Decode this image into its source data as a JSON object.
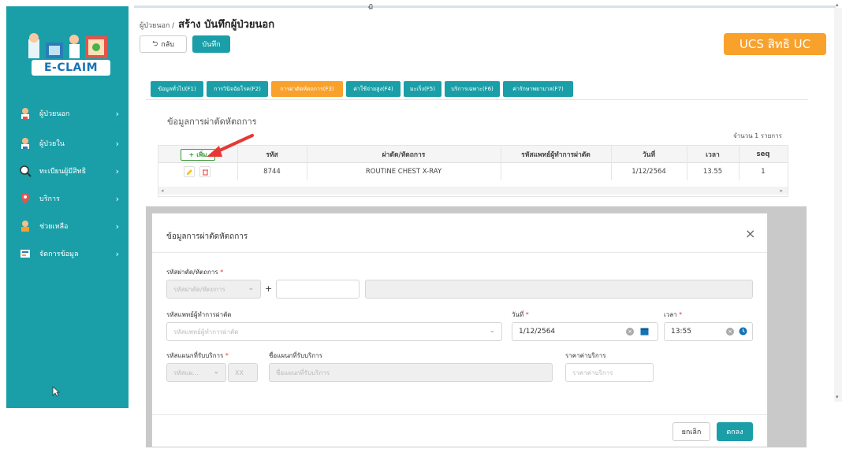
{
  "colors": {
    "primary": "#1a9fa8",
    "accent": "#f8a12b",
    "required": "#e53935",
    "add": "#3a9a3a"
  },
  "top_mark": "ฏ",
  "sidebar": {
    "logo": "E-CLAIM",
    "items": [
      {
        "label": "ผู้ป่วยนอก",
        "icon": "doctor-opd-icon"
      },
      {
        "label": "ผู้ป่วยใน",
        "icon": "doctor-ipd-icon"
      },
      {
        "label": "ทะเบียนผู้มีสิทธิ",
        "icon": "search-doc-icon"
      },
      {
        "label": "บริการ",
        "icon": "location-pin-icon"
      },
      {
        "label": "ช่วยเหลือ",
        "icon": "helper-person-icon"
      },
      {
        "label": "จัดการข้อมูล",
        "icon": "data-manage-icon"
      }
    ],
    "chevron": "›"
  },
  "header": {
    "breadcrumb_parent": "ผู้ป่วยนอก /",
    "title": "สร้าง บันทึกผู้ป่วยนอก",
    "back_label": "กลับ",
    "save_label": "บันทึก",
    "badge": "UCS สิทธิ UC"
  },
  "tabs": [
    {
      "label": "ข้อมูลทั่วไป(F1)",
      "active": false
    },
    {
      "label": "การวินิจฉัยโรค(F2)",
      "active": false
    },
    {
      "label": "การผ่าตัดหัตถการ(F3)",
      "active": true
    },
    {
      "label": "ค่าใช้จ่ายสูง(F4)",
      "active": false
    },
    {
      "label": "มะเร็ง(F5)",
      "active": false
    },
    {
      "label": "บริการเฉพาะ(F6)",
      "active": false
    },
    {
      "label": "ค่ารักษาพยาบาล(F7)",
      "active": false
    }
  ],
  "section": {
    "title": "ข้อมูลการผ่าตัดหัตถการ",
    "count": "จำนวน 1 รายการ"
  },
  "table": {
    "add_label": "เพิ่ม",
    "headers": [
      "รหัส",
      "ผ่าตัด/หัตถการ",
      "รหัสแพทย์ผู้ทำการผ่าตัด",
      "วันที่",
      "เวลา",
      "seq"
    ],
    "rows": [
      {
        "code": "8744",
        "procedure": "ROUTINE CHEST X-RAY",
        "doctor": "",
        "date": "1/12/2564",
        "time": "13.55",
        "seq": "1"
      }
    ]
  },
  "modal": {
    "title": "ข้อมูลการผ่าตัดหัตถการ",
    "procedure_code_label": "รหัสผ่าตัด/หัตถการ",
    "procedure_code_placeholder": "รหัสผ่าตัด/หัตถการ",
    "procedure_code_value": "",
    "procedure_name_value": "",
    "doctor_label": "รหัสแพทย์ผู้ทำการผ่าตัด",
    "doctor_placeholder": "รหัสแพทย์ผู้ทำการผ่าตัด",
    "date_label": "วันที่",
    "date_value": "1/12/2564",
    "time_label": "เวลา",
    "time_value": "13:55",
    "dept_code_label": "รหัสแผนกที่รับบริการ",
    "dept_code_placeholder": "รหัสแผ...",
    "dept_code_suffix": "XX",
    "dept_name_label": "ชื่อแผนกที่รับบริการ",
    "dept_name_placeholder": "ชื่อแผนกที่รับบริการ",
    "price_label": "ราคาค่าบริการ",
    "price_placeholder": "ราคาค่าบริการ",
    "cancel_label": "ยกเลิก",
    "ok_label": "ตกลง"
  }
}
